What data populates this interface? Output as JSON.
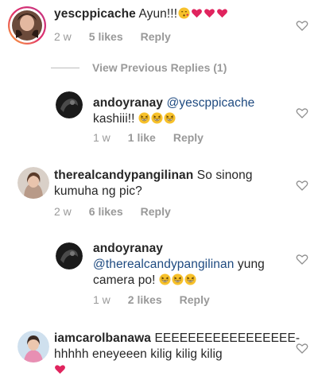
{
  "comments": [
    {
      "username": "yescppicache",
      "text": "Ayun!!!",
      "time": "2 w",
      "likes": "5 likes",
      "reply": "Reply",
      "emoji": [
        "smiling-kissing-face",
        "red-heart",
        "red-heart",
        "red-heart"
      ]
    },
    {
      "username": "andoyranay",
      "mention": "@yescppicache",
      "text": "kashiii!!",
      "time": "1 w",
      "likes": "1 like",
      "reply": "Reply",
      "emoji": [
        "grinning-squinting-face",
        "grinning-squinting-face",
        "grinning-squinting-face"
      ]
    },
    {
      "username": "therealcandypangilinan",
      "text_line1": "So sinong",
      "text_line2": "kumuha ng pic?",
      "time": "2 w",
      "likes": "6 likes",
      "reply": "Reply"
    },
    {
      "username": "andoyranay",
      "mention": "@therealcandypangilinan",
      "text_after_mention": "yung",
      "text_line2": "camera po!",
      "time": "1 w",
      "likes": "2 likes",
      "reply": "Reply",
      "emoji": [
        "grinning-squinting-face",
        "grinning-squinting-face",
        "grinning-squinting-face"
      ]
    },
    {
      "username": "iamcarolbanawa",
      "text_line1": "EEEEEEEEEEEEEEEEE-",
      "text_line2": "hhhhh eneyeeen kilig kilig kilig",
      "emoji": [
        "red-heart"
      ]
    }
  ],
  "view_previous": "View Previous Replies (1)",
  "colors": {
    "text": "#262626",
    "meta": "#9a9a9a",
    "mention": "#1e4a80",
    "heart": "#e0245e",
    "story_ring": "#d6249f"
  },
  "icons": {
    "like": "heart-outline-icon"
  }
}
